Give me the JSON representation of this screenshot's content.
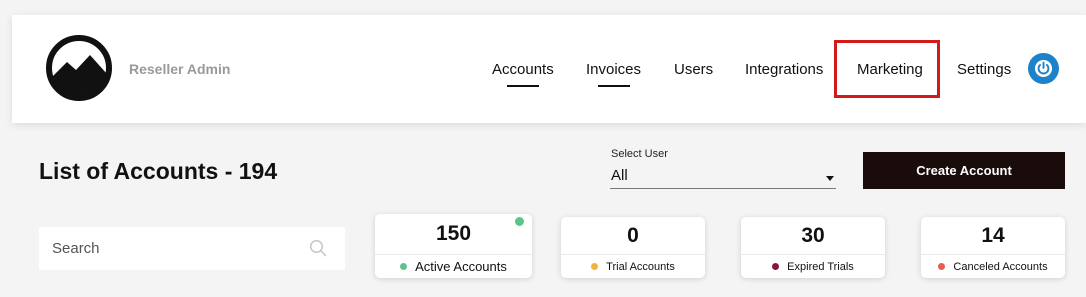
{
  "header": {
    "brand": "Reseller Admin",
    "nav": [
      {
        "label": "Accounts",
        "underline": true
      },
      {
        "label": "Invoices",
        "underline": true
      },
      {
        "label": "Users",
        "underline": false
      },
      {
        "label": "Integrations",
        "underline": false
      },
      {
        "label": "Marketing",
        "underline": false,
        "highlighted": true
      },
      {
        "label": "Settings",
        "underline": false
      }
    ],
    "power_icon": "power-icon",
    "accent_color": "#1e82c8",
    "highlight_color": "#d21a1a"
  },
  "main": {
    "title": "List of Accounts - 194",
    "select_user": {
      "label": "Select User",
      "value": "All"
    },
    "create_button": "Create Account",
    "search": {
      "placeholder": "Search",
      "value": ""
    },
    "stats": [
      {
        "value": "150",
        "label": "Active Accounts",
        "dot_color": "#5cc489",
        "selected": true
      },
      {
        "value": "0",
        "label": "Trial Accounts",
        "dot_color": "#f3b33d",
        "selected": false
      },
      {
        "value": "30",
        "label": "Expired Trials",
        "dot_color": "#8b1538",
        "selected": false
      },
      {
        "value": "14",
        "label": "Canceled Accounts",
        "dot_color": "#ee5a4f",
        "selected": false
      }
    ]
  }
}
